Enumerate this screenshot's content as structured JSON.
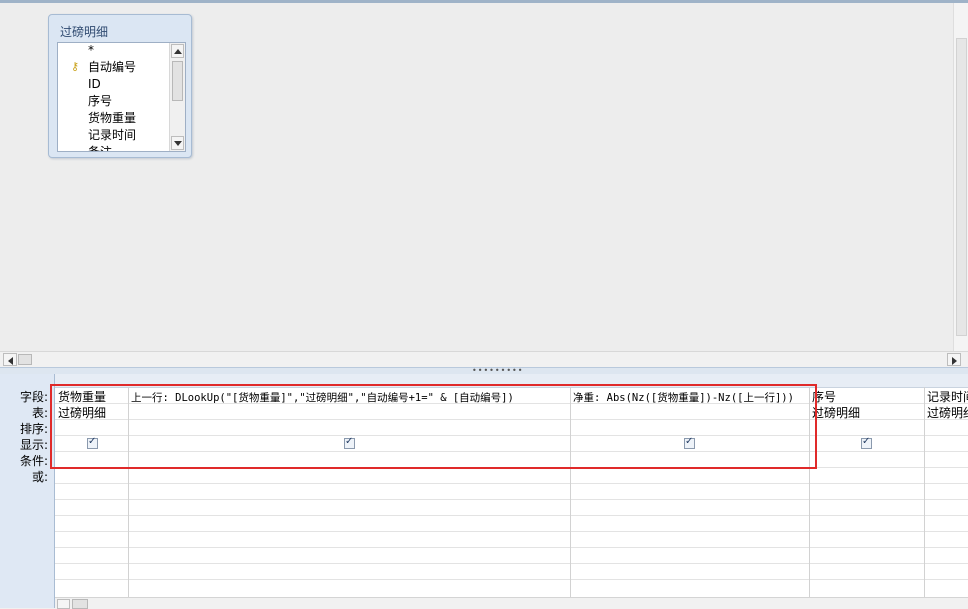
{
  "table_box": {
    "title": "过磅明细",
    "fields": [
      "*",
      "自动编号",
      "ID",
      "序号",
      "货物重量",
      "记录时间",
      "备注"
    ]
  },
  "grid": {
    "row_labels": [
      "字段:",
      "表:",
      "排序:",
      "显示:",
      "条件:",
      "或:"
    ],
    "columns": [
      {
        "field": "货物重量",
        "table": "过磅明细",
        "show": true
      },
      {
        "field": "上一行: DLookUp(\"[货物重量]\",\"过磅明细\",\"自动编号+1=\" & [自动编号])",
        "table": "",
        "show": true
      },
      {
        "field": "净重: Abs(Nz([货物重量])-Nz([上一行]))",
        "table": "",
        "show": true
      },
      {
        "field": "序号",
        "table": "过磅明细",
        "show": true
      },
      {
        "field": "记录时间",
        "table": "过磅明细",
        "show": true
      }
    ]
  },
  "colors": {
    "highlight_box": "#e02a2a",
    "panel_header": "#dfe8f4"
  }
}
